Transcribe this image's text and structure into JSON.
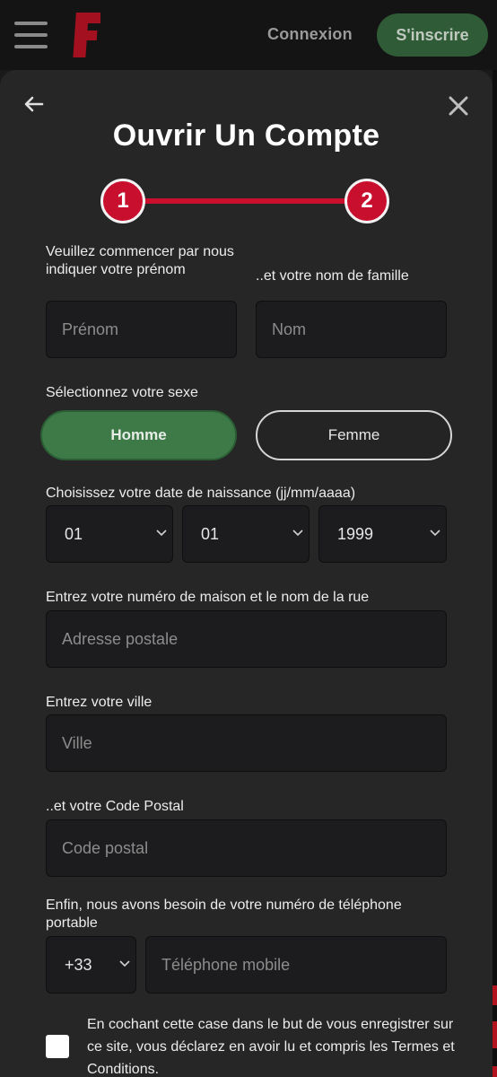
{
  "topbar": {
    "logo_letter": "F",
    "login_label": "Connexion",
    "signup_label": "S'inscrire"
  },
  "form": {
    "title": "Ouvrir Un Compte",
    "steps": [
      "1",
      "2"
    ],
    "first_name_label": "Veuillez commencer par nous indiquer votre prénom",
    "first_name_placeholder": "Prénom",
    "last_name_label": "..et votre nom de famille",
    "last_name_placeholder": "Nom",
    "gender_label": "Sélectionnez votre sexe",
    "gender_options": [
      "Homme",
      "Femme"
    ],
    "gender_selected": "Homme",
    "dob_label": "Choisissez votre date de naissance (jj/mm/aaaa)",
    "dob_day": "01",
    "dob_month": "01",
    "dob_year": "1999",
    "address_label": "Entrez votre numéro de maison et le nom de la rue",
    "address_placeholder": "Adresse postale",
    "city_label": "Entrez votre ville",
    "city_placeholder": "Ville",
    "postcode_label": "..et votre Code Postal",
    "postcode_placeholder": "Code postal",
    "phone_label": "Enfin, nous avons besoin de votre numéro de téléphone portable",
    "phone_prefix": "+33",
    "phone_placeholder": "Téléphone mobile",
    "terms_text": "En cochant cette case dans le but de vous enregistrer sur ce site, vous déclarez en avoir lu et compris les Termes et Conditions."
  },
  "colors": {
    "brand_red": "#c8102e",
    "accent_green": "#3d7a47",
    "panel_bg": "#262626"
  }
}
